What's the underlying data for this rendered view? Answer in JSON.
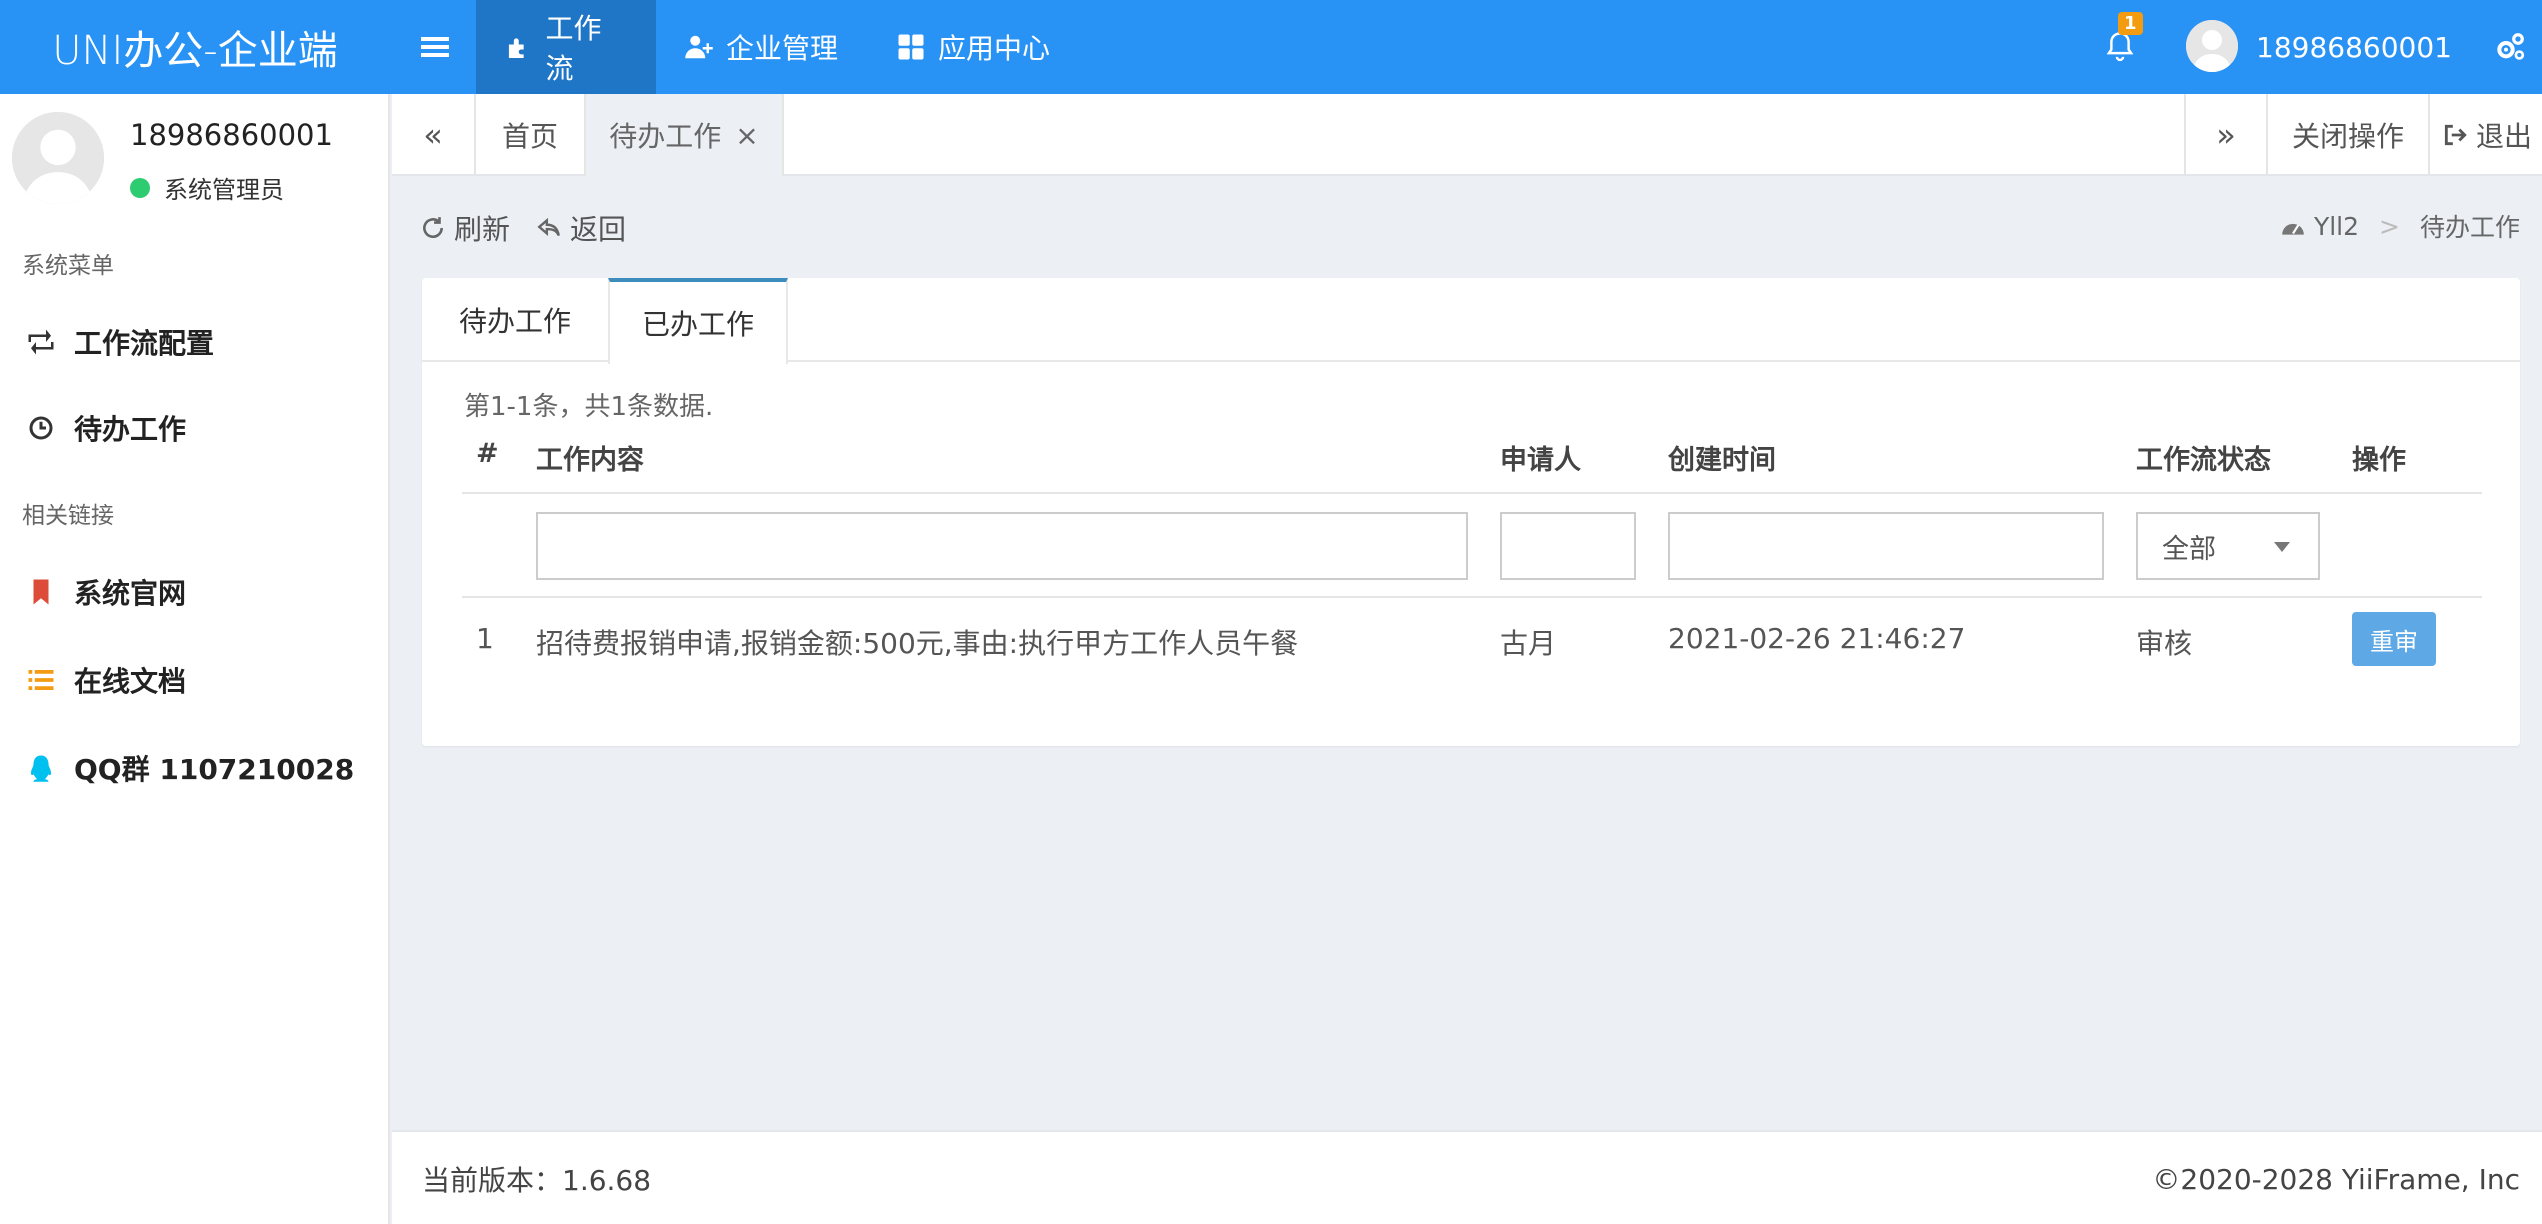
{
  "app": {
    "logo": "UNI办公-企业端"
  },
  "topnav": {
    "items": [
      {
        "label": "工作流",
        "icon": "puzzle-icon"
      },
      {
        "label": "企业管理",
        "icon": "user-plus-icon"
      },
      {
        "label": "应用中心",
        "icon": "grid-icon"
      }
    ],
    "notification_count": "1",
    "username": "18986860001"
  },
  "sidebar": {
    "username": "18986860001",
    "role": "系统管理员",
    "menu_header": "系统菜单",
    "menu": [
      {
        "label": "工作流配置",
        "icon": "retweet-icon"
      },
      {
        "label": "待办工作",
        "icon": "clock-icon"
      }
    ],
    "links_header": "相关链接",
    "links": [
      {
        "label": "系统官网",
        "icon": "bookmark-icon"
      },
      {
        "label": "在线文档",
        "icon": "list-icon"
      },
      {
        "label": "QQ群 1107210028",
        "icon": "qq-icon"
      }
    ]
  },
  "tabsbar": {
    "home": "首页",
    "current": "待办工作",
    "close_ops": "关闭操作",
    "logout": "退出"
  },
  "toolbar": {
    "refresh": "刷新",
    "back": "返回"
  },
  "breadcrumb": {
    "root": "Yll2",
    "separator": ">",
    "current": "待办工作"
  },
  "content": {
    "tabs": [
      "待办工作",
      "已办工作"
    ],
    "active_tab": 1,
    "summary": "第1-1条，共1条数据.",
    "columns": [
      "#",
      "工作内容",
      "申请人",
      "创建时间",
      "工作流状态",
      "操作"
    ],
    "status_filter": "全部",
    "rows": [
      {
        "index": "1",
        "content": "招待费报销申请,报销金额:500元,事由:执行甲方工作人员午餐",
        "applicant": "古月",
        "created": "2021-02-26 21:46:27",
        "status": "审核",
        "action": "重审"
      }
    ]
  },
  "footer": {
    "version": "当前版本：1.6.68",
    "copyright": "©2020-2028 YiiFrame, Inc"
  }
}
